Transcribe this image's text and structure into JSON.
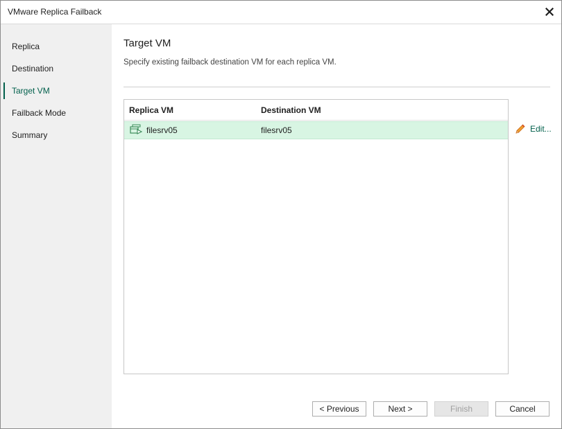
{
  "window": {
    "title": "VMware Replica Failback",
    "close_glyph": "✕"
  },
  "sidebar": {
    "items": [
      {
        "label": "Replica",
        "active": false
      },
      {
        "label": "Destination",
        "active": false
      },
      {
        "label": "Target VM",
        "active": true
      },
      {
        "label": "Failback Mode",
        "active": false
      },
      {
        "label": "Summary",
        "active": false
      }
    ]
  },
  "main": {
    "title": "Target VM",
    "subtitle": "Specify existing failback destination VM for each replica VM.",
    "table": {
      "columns": [
        "Replica VM",
        "Destination VM"
      ],
      "rows": [
        {
          "replica_vm": "filesrv05",
          "destination_vm": "filesrv05",
          "icon": "vm-replica-icon",
          "selected": true
        }
      ]
    },
    "edit_label": "Edit..."
  },
  "footer": {
    "previous": "< Previous",
    "next": "Next >",
    "finish": "Finish",
    "cancel": "Cancel"
  },
  "colors": {
    "accent": "#005f4b",
    "selected_row": "#d8f5e3",
    "sidebar_bg": "#f0f0f0"
  }
}
